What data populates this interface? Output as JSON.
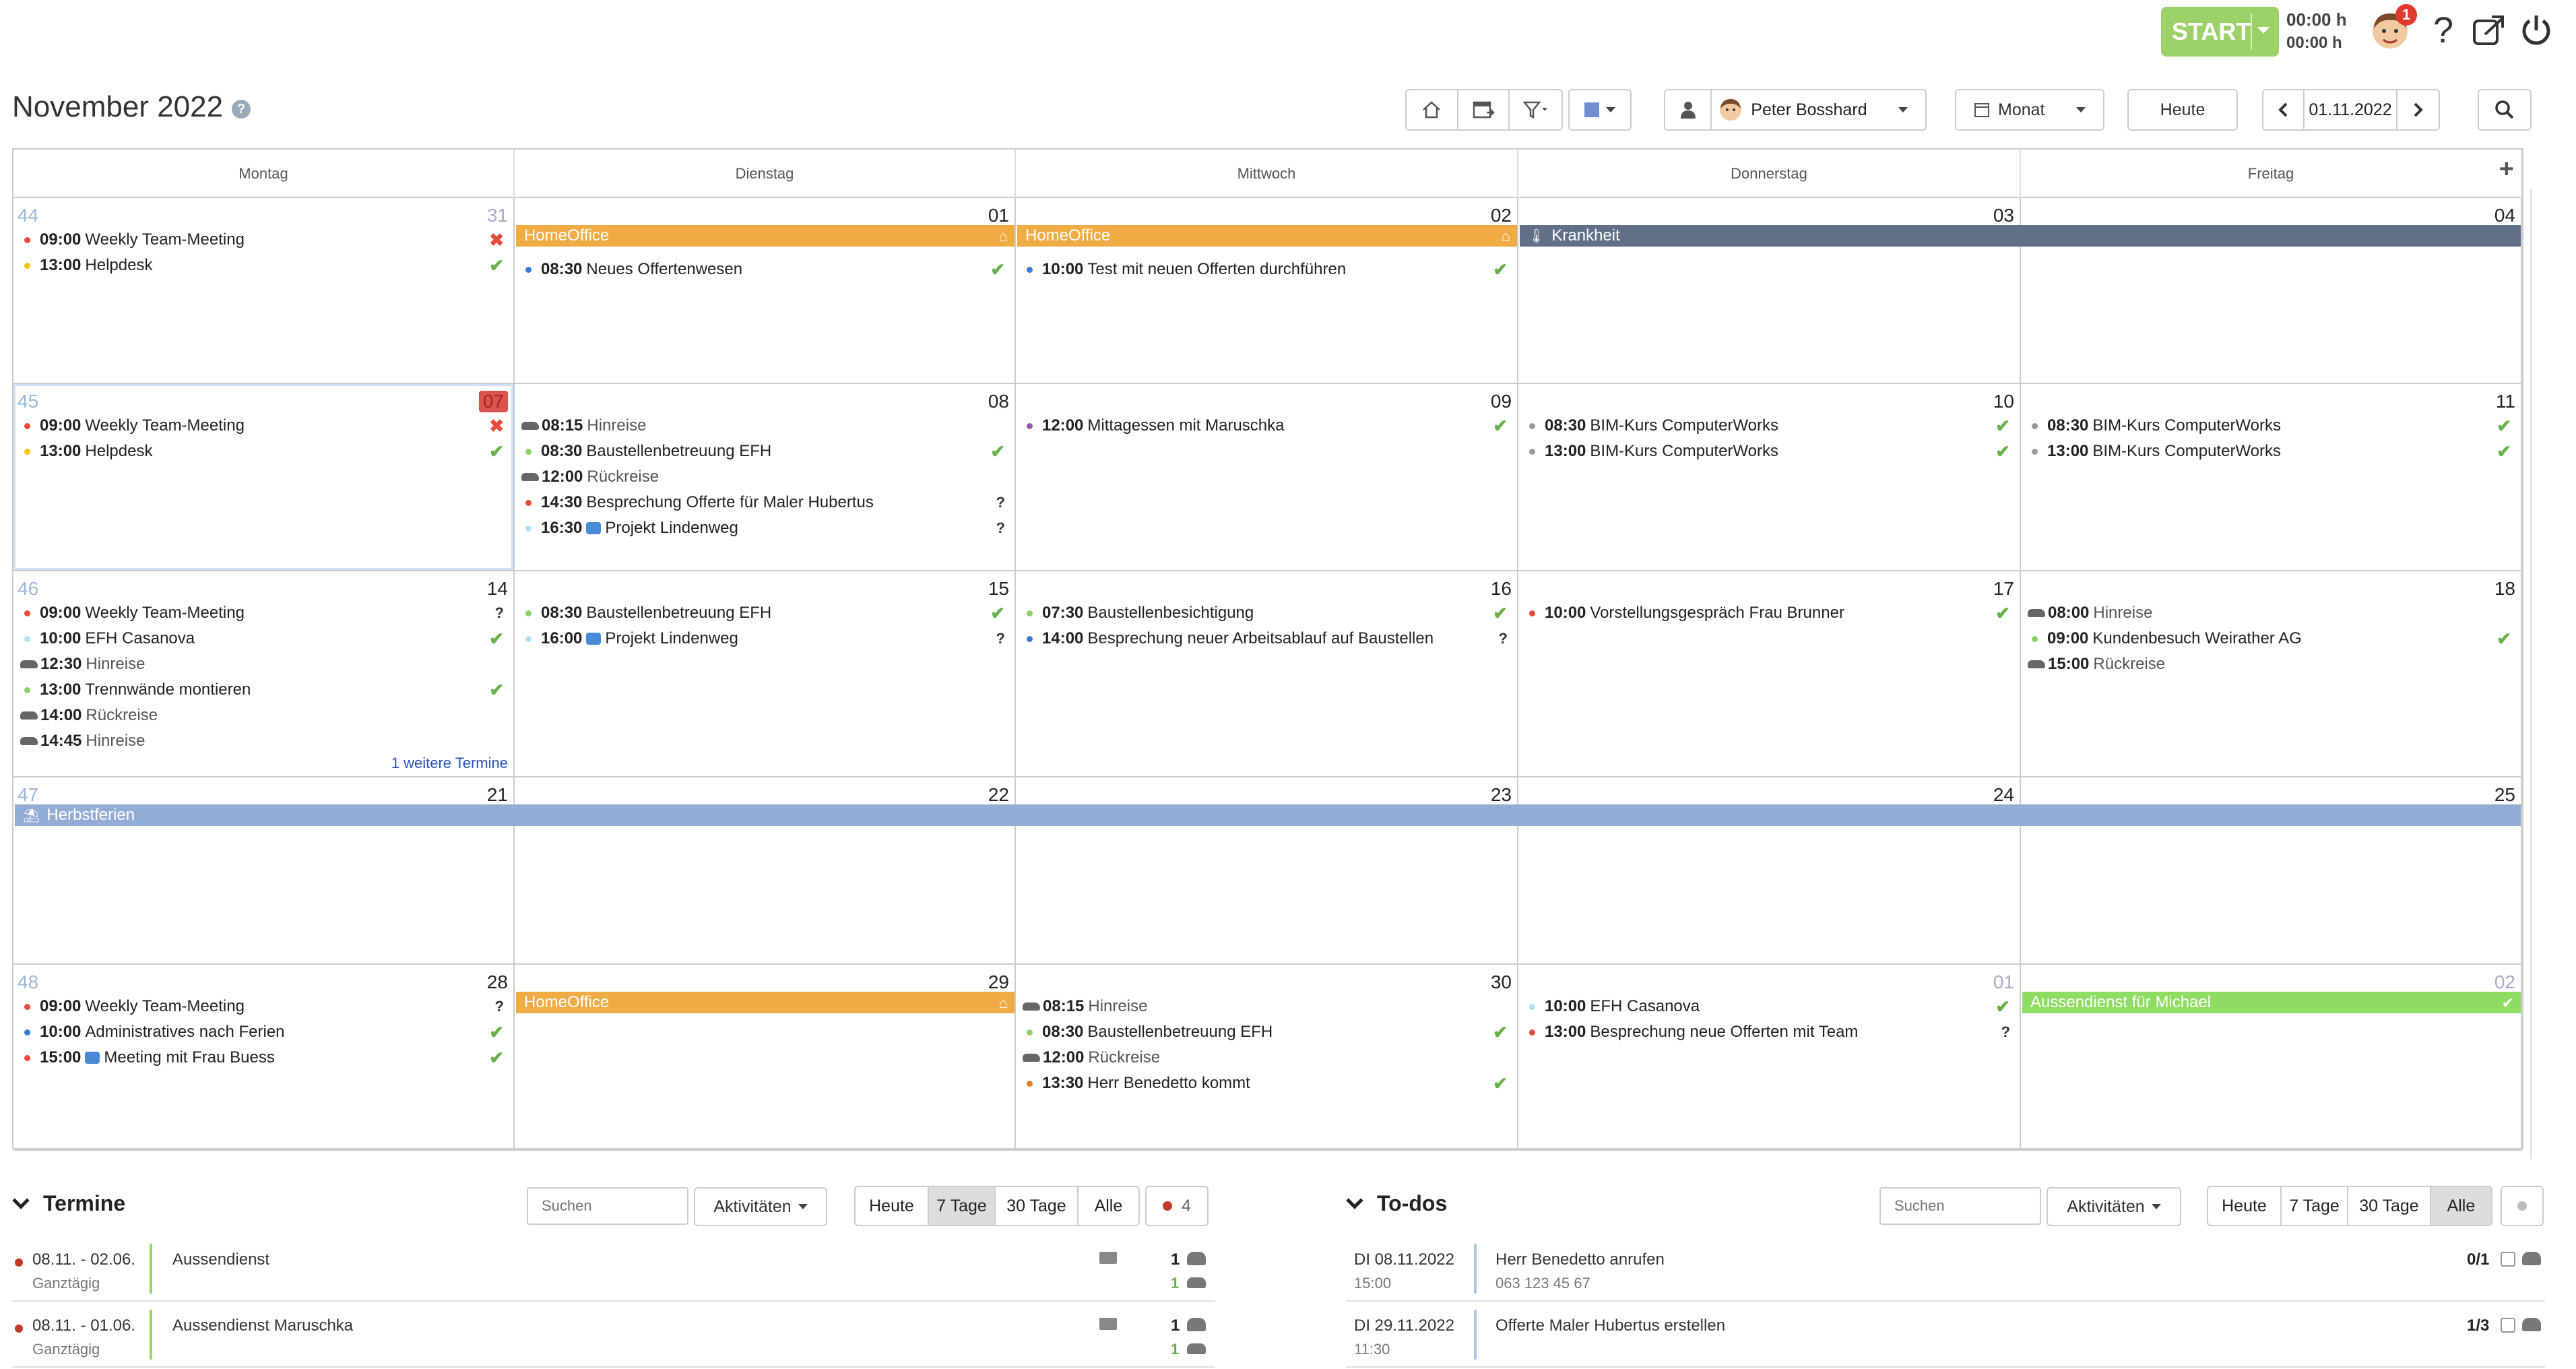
{
  "topbar": {
    "start_label": "START",
    "time1": "00:00 h",
    "time2": "00:00 h",
    "notification_count": "1"
  },
  "header": {
    "title": "November 2022",
    "help": "?",
    "user": "Peter Bosshard",
    "view": "Monat",
    "today": "Heute",
    "date": "01.11.2022"
  },
  "calendar": {
    "daynames": [
      "Montag",
      "Dienstag",
      "Mittwoch",
      "Donnerstag",
      "Freitag"
    ],
    "more_link": "1 weitere Termine",
    "weeks": [
      {
        "kw": "44",
        "days": [
          {
            "n": "31",
            "other": true,
            "events": [
              {
                "t": "09:00",
                "x": "Weekly Team-Meeting",
                "c": "#e74c3c",
                "s": "no"
              },
              {
                "t": "13:00",
                "x": "Helpdesk",
                "c": "#f1c40f",
                "s": "ok"
              }
            ]
          },
          {
            "n": "01",
            "events": [
              {
                "t": "08:30",
                "x": "Neues Offertenwesen",
                "c": "#3a7bd5",
                "s": "ok"
              }
            ]
          },
          {
            "n": "02",
            "events": [
              {
                "t": "10:00",
                "x": "Test mit neuen Offerten durchführen",
                "c": "#3a7bd5",
                "s": "ok"
              }
            ]
          },
          {
            "n": "03",
            "events": []
          },
          {
            "n": "04",
            "events": []
          }
        ]
      },
      {
        "kw": "45",
        "days": [
          {
            "n": "07",
            "today": true,
            "events": [
              {
                "t": "09:00",
                "x": "Weekly Team-Meeting",
                "c": "#e74c3c",
                "s": "no"
              },
              {
                "t": "13:00",
                "x": "Helpdesk",
                "c": "#f1c40f",
                "s": "ok"
              }
            ]
          },
          {
            "n": "08",
            "events": [
              {
                "t": "08:15",
                "x": "Hinreise",
                "car": true,
                "g": true
              },
              {
                "t": "08:30",
                "x": "Baustellenbetreuung EFH",
                "c": "#8ed06a",
                "s": "ok"
              },
              {
                "t": "12:00",
                "x": "Rückreise",
                "car": true,
                "g": true
              },
              {
                "t": "14:30",
                "x": "Besprechung Offerte für Maler Hubertus",
                "c": "#e74c3c",
                "s": "q"
              },
              {
                "t": "16:30",
                "x": "Projekt Lindenweg",
                "c": "#aee0f0",
                "cam": true,
                "s": "q"
              }
            ]
          },
          {
            "n": "09",
            "events": [
              {
                "t": "12:00",
                "x": "Mittagessen mit Maruschka",
                "c": "#9b59b6",
                "s": "ok"
              }
            ]
          },
          {
            "n": "10",
            "events": [
              {
                "t": "08:30",
                "x": "BIM-Kurs ComputerWorks",
                "c": "#999",
                "s": "ok"
              },
              {
                "t": "13:00",
                "x": "BIM-Kurs ComputerWorks",
                "c": "#999",
                "s": "ok"
              }
            ]
          },
          {
            "n": "11",
            "events": [
              {
                "t": "08:30",
                "x": "BIM-Kurs ComputerWorks",
                "c": "#999",
                "s": "ok"
              },
              {
                "t": "13:00",
                "x": "BIM-Kurs ComputerWorks",
                "c": "#999",
                "s": "ok"
              }
            ]
          }
        ]
      },
      {
        "kw": "46",
        "days": [
          {
            "n": "14",
            "events": [
              {
                "t": "09:00",
                "x": "Weekly Team-Meeting",
                "c": "#e74c3c",
                "s": "q"
              },
              {
                "t": "10:00",
                "x": "EFH Casanova",
                "c": "#aee0f0",
                "s": "ok"
              },
              {
                "t": "12:30",
                "x": "Hinreise",
                "car": true,
                "g": true
              },
              {
                "t": "13:00",
                "x": "Trennwände montieren",
                "c": "#8ed06a",
                "s": "ok"
              },
              {
                "t": "14:00",
                "x": "Rückreise",
                "car": true,
                "g": true
              },
              {
                "t": "14:45",
                "x": "Hinreise",
                "car": true,
                "g": true
              }
            ]
          },
          {
            "n": "15",
            "events": [
              {
                "t": "08:30",
                "x": "Baustellenbetreuung EFH",
                "c": "#8ed06a",
                "s": "ok"
              },
              {
                "t": "16:00",
                "x": "Projekt Lindenweg",
                "c": "#aee0f0",
                "cam": true,
                "s": "q"
              }
            ]
          },
          {
            "n": "16",
            "events": [
              {
                "t": "07:30",
                "x": "Baustellenbesichtigung",
                "c": "#8ed06a",
                "s": "ok"
              },
              {
                "t": "14:00",
                "x": "Besprechung neuer Arbeitsablauf auf Baustellen",
                "c": "#3a7bd5",
                "s": "q"
              }
            ]
          },
          {
            "n": "17",
            "events": [
              {
                "t": "10:00",
                "x": "Vorstellungsgespräch Frau Brunner",
                "c": "#e74c3c",
                "s": "ok"
              }
            ]
          },
          {
            "n": "18",
            "events": [
              {
                "t": "08:00",
                "x": "Hinreise",
                "car": true,
                "g": true
              },
              {
                "t": "09:00",
                "x": "Kundenbesuch Weirather AG",
                "c": "#8ed06a",
                "s": "ok"
              },
              {
                "t": "15:00",
                "x": "Rückreise",
                "car": true,
                "g": true
              }
            ]
          }
        ]
      },
      {
        "kw": "47",
        "days": [
          {
            "n": "21",
            "events": []
          },
          {
            "n": "22",
            "events": []
          },
          {
            "n": "23",
            "events": []
          },
          {
            "n": "24",
            "events": []
          },
          {
            "n": "25",
            "events": []
          }
        ]
      },
      {
        "kw": "48",
        "days": [
          {
            "n": "28",
            "events": [
              {
                "t": "09:00",
                "x": "Weekly Team-Meeting",
                "c": "#e74c3c",
                "s": "q"
              },
              {
                "t": "10:00",
                "x": "Administratives nach Ferien",
                "c": "#3a7bd5",
                "s": "ok"
              },
              {
                "t": "15:00",
                "x": "Meeting mit Frau Buess",
                "c": "#e74c3c",
                "cam": true,
                "s": "ok"
              }
            ]
          },
          {
            "n": "29",
            "events": []
          },
          {
            "n": "30",
            "events": [
              {
                "t": "08:15",
                "x": "Hinreise",
                "car": true,
                "g": true
              },
              {
                "t": "08:30",
                "x": "Baustellenbetreuung EFH",
                "c": "#8ed06a",
                "s": "ok"
              },
              {
                "t": "12:00",
                "x": "Rückreise",
                "car": true,
                "g": true
              },
              {
                "t": "13:30",
                "x": "Herr Benedetto kommt",
                "c": "#e67e22",
                "s": "ok"
              }
            ]
          },
          {
            "n": "01",
            "other": true,
            "events": [
              {
                "t": "10:00",
                "x": "EFH Casanova",
                "c": "#aee0f0",
                "s": "ok"
              },
              {
                "t": "13:00",
                "x": "Besprechung neue Offerten mit Team",
                "c": "#e74c3c",
                "s": "q"
              }
            ]
          },
          {
            "n": "02",
            "other": true,
            "events": []
          }
        ]
      }
    ],
    "bars": [
      {
        "week": 0,
        "from": 1,
        "to": 1,
        "label": "HomeOffice",
        "color": "#efab44",
        "icon": "home"
      },
      {
        "week": 0,
        "from": 2,
        "to": 2,
        "label": "HomeOffice",
        "color": "#efab44",
        "icon": "home"
      },
      {
        "week": 0,
        "from": 3,
        "to": 4,
        "label": "Krankheit",
        "color": "#607088",
        "icon": "therm"
      },
      {
        "week": 3,
        "from": 0,
        "to": 4,
        "label": "Herbstferien",
        "color": "#93acd6",
        "icon": "beach"
      },
      {
        "week": 4,
        "from": 1,
        "to": 1,
        "label": "HomeOffice",
        "color": "#efab44",
        "icon": "home"
      },
      {
        "week": 4,
        "from": 4,
        "to": 4,
        "label": "Aussendienst für Michael",
        "color": "#8fdc63",
        "icon": "check"
      }
    ]
  },
  "termine": {
    "title": "Termine",
    "search_placeholder": "Suchen",
    "activities": "Aktivitäten",
    "filters": [
      "Heute",
      "7 Tage",
      "30 Tage",
      "Alle"
    ],
    "active_filter": 1,
    "dot_count": "4",
    "rows": [
      {
        "date": "08.11. - 02.06.",
        "sub": "Ganztägig",
        "title": "Aussendienst",
        "count": "1",
        "count2": "1"
      },
      {
        "date": "08.11. - 01.06.",
        "sub": "Ganztägig",
        "title": "Aussendienst Maruschka",
        "count": "1",
        "count2": "1"
      }
    ]
  },
  "todos": {
    "title": "To-dos",
    "search_placeholder": "Suchen",
    "activities": "Aktivitäten",
    "filters": [
      "Heute",
      "7 Tage",
      "30 Tage",
      "Alle"
    ],
    "active_filter": 3,
    "rows": [
      {
        "date": "DI 08.11.2022",
        "sub": "15:00",
        "title": "Herr Benedetto anrufen",
        "title2": "063 123 45 67",
        "count": "0/1"
      },
      {
        "date": "DI 29.11.2022",
        "sub": "11:30",
        "title": "Offerte Maler Hubertus erstellen",
        "title2": "",
        "count": "1/3"
      }
    ]
  }
}
